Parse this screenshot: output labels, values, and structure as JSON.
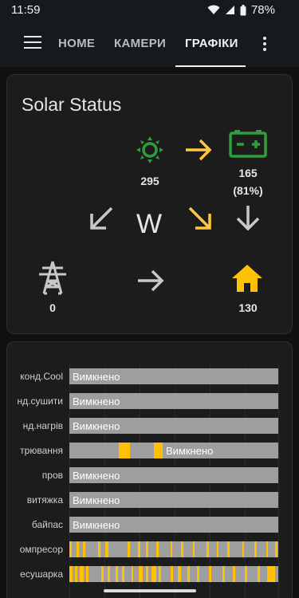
{
  "status_bar": {
    "time": "11:59",
    "battery": "78%"
  },
  "toolbar": {
    "tabs": [
      {
        "label": "HOME",
        "active": false
      },
      {
        "label": "КАМЕРИ",
        "active": false
      },
      {
        "label": "ГРАФІКИ",
        "active": true
      }
    ]
  },
  "solar": {
    "title": "Solar Status",
    "solar_value": "295",
    "battery_value": "165",
    "battery_percent": "(81%)",
    "direction": "W",
    "grid_value": "0",
    "home_value": "130",
    "colors": {
      "solar": "#2e9e3e",
      "battery": "#2e9e3e",
      "flow_active": "#ffc93c",
      "flow_inactive": "#c8c8c8",
      "home": "#ffc107"
    }
  },
  "history": {
    "rows": [
      {
        "label": "конд.Cool",
        "state": "Вимкнено"
      },
      {
        "label": "нд.сушити",
        "state": "Вимкнено"
      },
      {
        "label": "нд.нагрів",
        "state": "Вимкнено"
      },
      {
        "label": "трювання",
        "state": "Вимкнено"
      },
      {
        "label": "пров",
        "state": "Вимкнено"
      },
      {
        "label": "витяжка",
        "state": "Вимкнено"
      },
      {
        "label": "байпас",
        "state": "Вимкнено"
      },
      {
        "label": "омпресор",
        "state": ""
      },
      {
        "label": "есушарка",
        "state": ""
      }
    ],
    "colors": {
      "off": "#9e9e9e",
      "on": "#ffc107"
    }
  }
}
